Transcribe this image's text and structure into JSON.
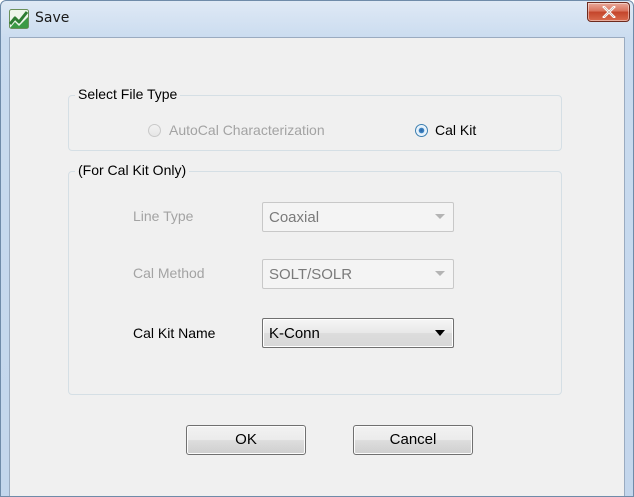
{
  "window": {
    "title": "Save",
    "close_icon": "close-x-icon",
    "app_icon": "app-logo-icon"
  },
  "file_type_group": {
    "legend": "Select File Type",
    "options": [
      {
        "label": "AutoCal Characterization",
        "selected": false,
        "enabled": false
      },
      {
        "label": "Cal Kit",
        "selected": true,
        "enabled": true
      }
    ]
  },
  "cal_kit_group": {
    "legend": "(For Cal Kit Only)",
    "line_type": {
      "label": "Line Type",
      "value": "Coaxial",
      "enabled": false
    },
    "cal_method": {
      "label": "Cal Method",
      "value": "SOLT/SOLR",
      "enabled": false
    },
    "cal_kit_name": {
      "label": "Cal Kit Name",
      "value": "K-Conn",
      "enabled": true
    }
  },
  "buttons": {
    "ok": "OK",
    "cancel": "Cancel"
  },
  "colors": {
    "title_gradient": "#c9dbef",
    "client_bg": "#f0f0f0",
    "close_button": "#c4452b",
    "disabled_text": "#a3a3a3"
  }
}
